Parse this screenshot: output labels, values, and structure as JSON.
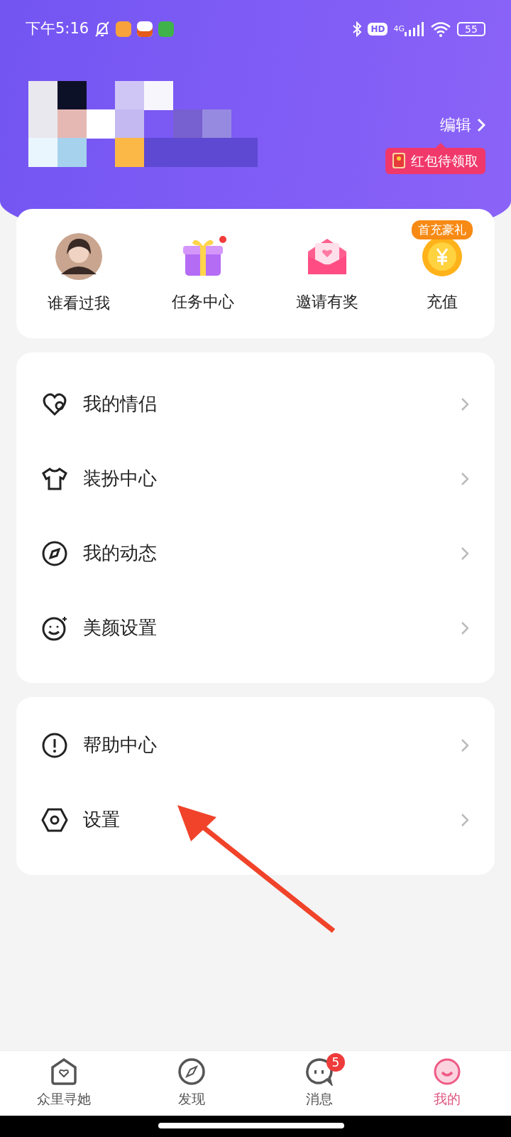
{
  "status_bar": {
    "time": "下午5:16",
    "hd": "HD",
    "network": "4G",
    "battery": "55"
  },
  "profile": {
    "kind": "picture",
    "edit": "编辑",
    "red_packet": "红包待领取"
  },
  "quick_actions": [
    {
      "kind": "avatar",
      "label": "谁看过我",
      "dot": false
    },
    {
      "kind": "gift",
      "label": "任务中心",
      "dot": true
    },
    {
      "kind": "invite",
      "label": "邀请有奖",
      "dot": false
    },
    {
      "kind": "coin",
      "label": "充值",
      "dot": false,
      "tag": "首充豪礼"
    }
  ],
  "menu_groups": [
    [
      {
        "kind": "heart",
        "label": "我的情侣"
      },
      {
        "kind": "shirt",
        "label": "装扮中心"
      },
      {
        "kind": "compass",
        "label": "我的动态"
      },
      {
        "kind": "smile",
        "label": "美颜设置"
      }
    ],
    [
      {
        "kind": "alert",
        "label": "帮助中心"
      },
      {
        "kind": "hexagon",
        "label": "设置"
      }
    ]
  ],
  "tabs": [
    {
      "kind": "home",
      "label": "众里寻她",
      "selected": false
    },
    {
      "kind": "compass",
      "label": "发现",
      "selected": false
    },
    {
      "kind": "chat",
      "label": "消息",
      "selected": false,
      "badge": "5"
    },
    {
      "kind": "face",
      "label": "我的",
      "selected": true
    }
  ]
}
